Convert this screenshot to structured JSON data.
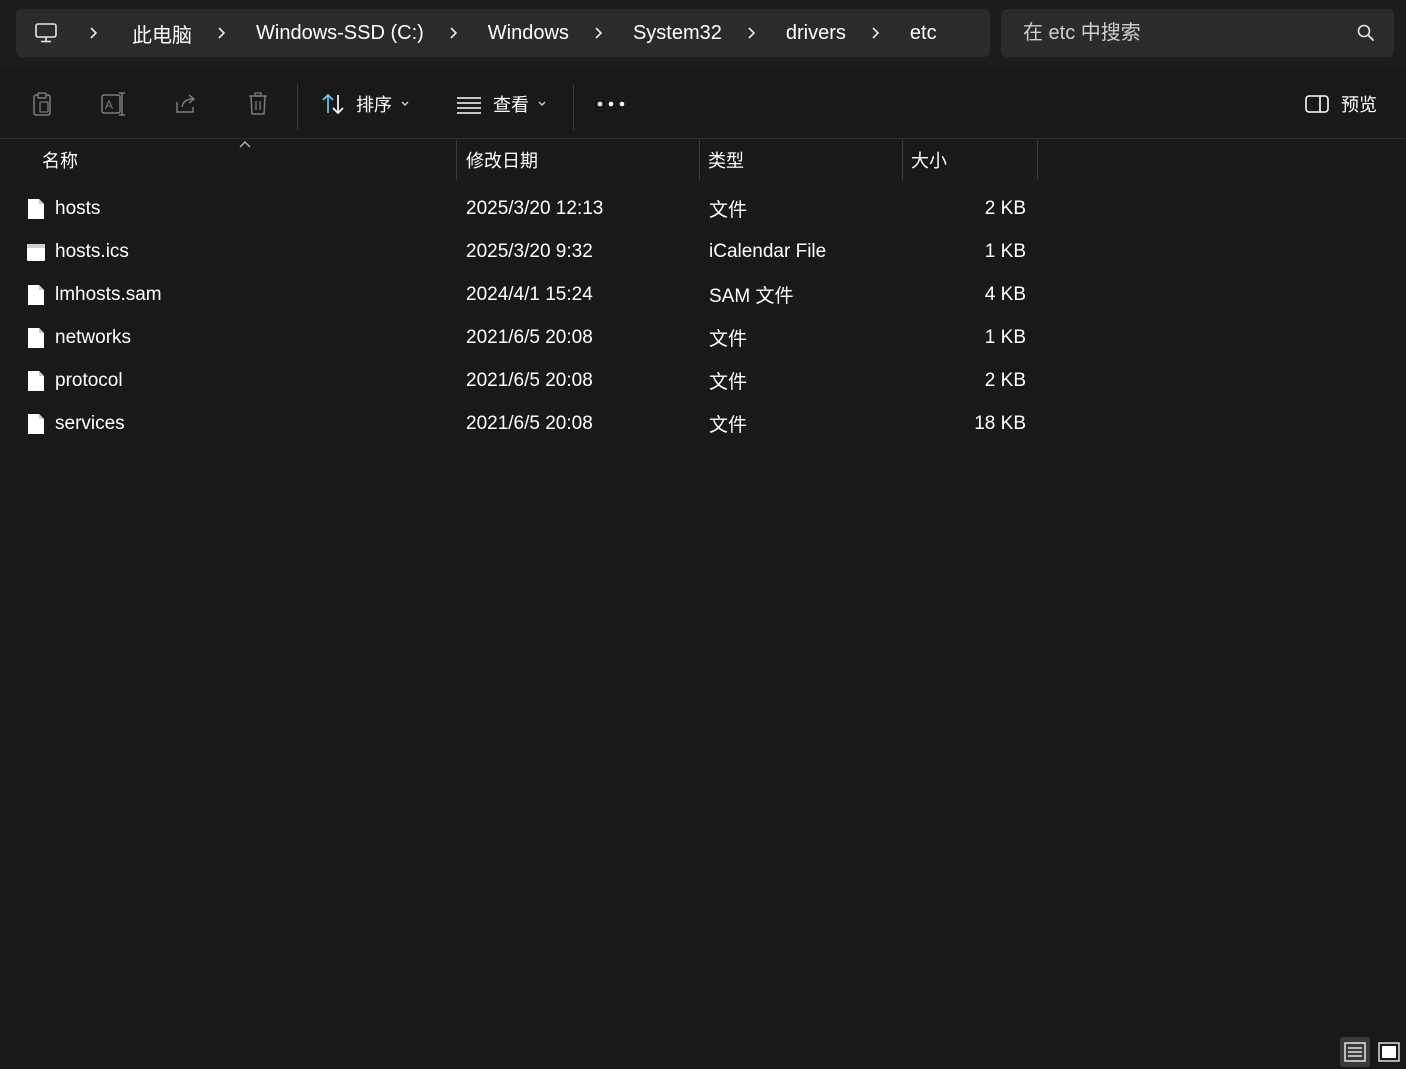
{
  "breadcrumb": {
    "items": [
      "此电脑",
      "Windows-SSD (C:)",
      "Windows",
      "System32",
      "drivers",
      "etc"
    ]
  },
  "search": {
    "placeholder": "在 etc 中搜索"
  },
  "toolbar": {
    "sort_label": "排序",
    "view_label": "查看",
    "more_label": "•••",
    "preview_label": "预览",
    "icons": [
      "paste-icon",
      "rename-icon",
      "share-icon",
      "delete-icon",
      "sort-icon",
      "view-icon",
      "more-icon",
      "preview-pane-icon"
    ]
  },
  "columns": {
    "name": "名称",
    "modified": "修改日期",
    "type": "类型",
    "size": "大小"
  },
  "files": [
    {
      "name": "hosts",
      "modified": "2025/3/20 12:13",
      "type": "文件",
      "size": "2 KB",
      "icon": "file-icon"
    },
    {
      "name": "hosts.ics",
      "modified": "2025/3/20 9:32",
      "type": "iCalendar File",
      "size": "1 KB",
      "icon": "calendar-file-icon"
    },
    {
      "name": "lmhosts.sam",
      "modified": "2024/4/1 15:24",
      "type": "SAM 文件",
      "size": "4 KB",
      "icon": "file-icon"
    },
    {
      "name": "networks",
      "modified": "2021/6/5 20:08",
      "type": "文件",
      "size": "1 KB",
      "icon": "file-icon"
    },
    {
      "name": "protocol",
      "modified": "2021/6/5 20:08",
      "type": "文件",
      "size": "2 KB",
      "icon": "file-icon"
    },
    {
      "name": "services",
      "modified": "2021/6/5 20:08",
      "type": "文件",
      "size": "18 KB",
      "icon": "file-icon"
    }
  ],
  "colors": {
    "background": "#191919",
    "bar": "#2b2b2b",
    "accent": "#60cdff",
    "text": "#ffffff",
    "muted_icon": "#7a7a7a"
  }
}
